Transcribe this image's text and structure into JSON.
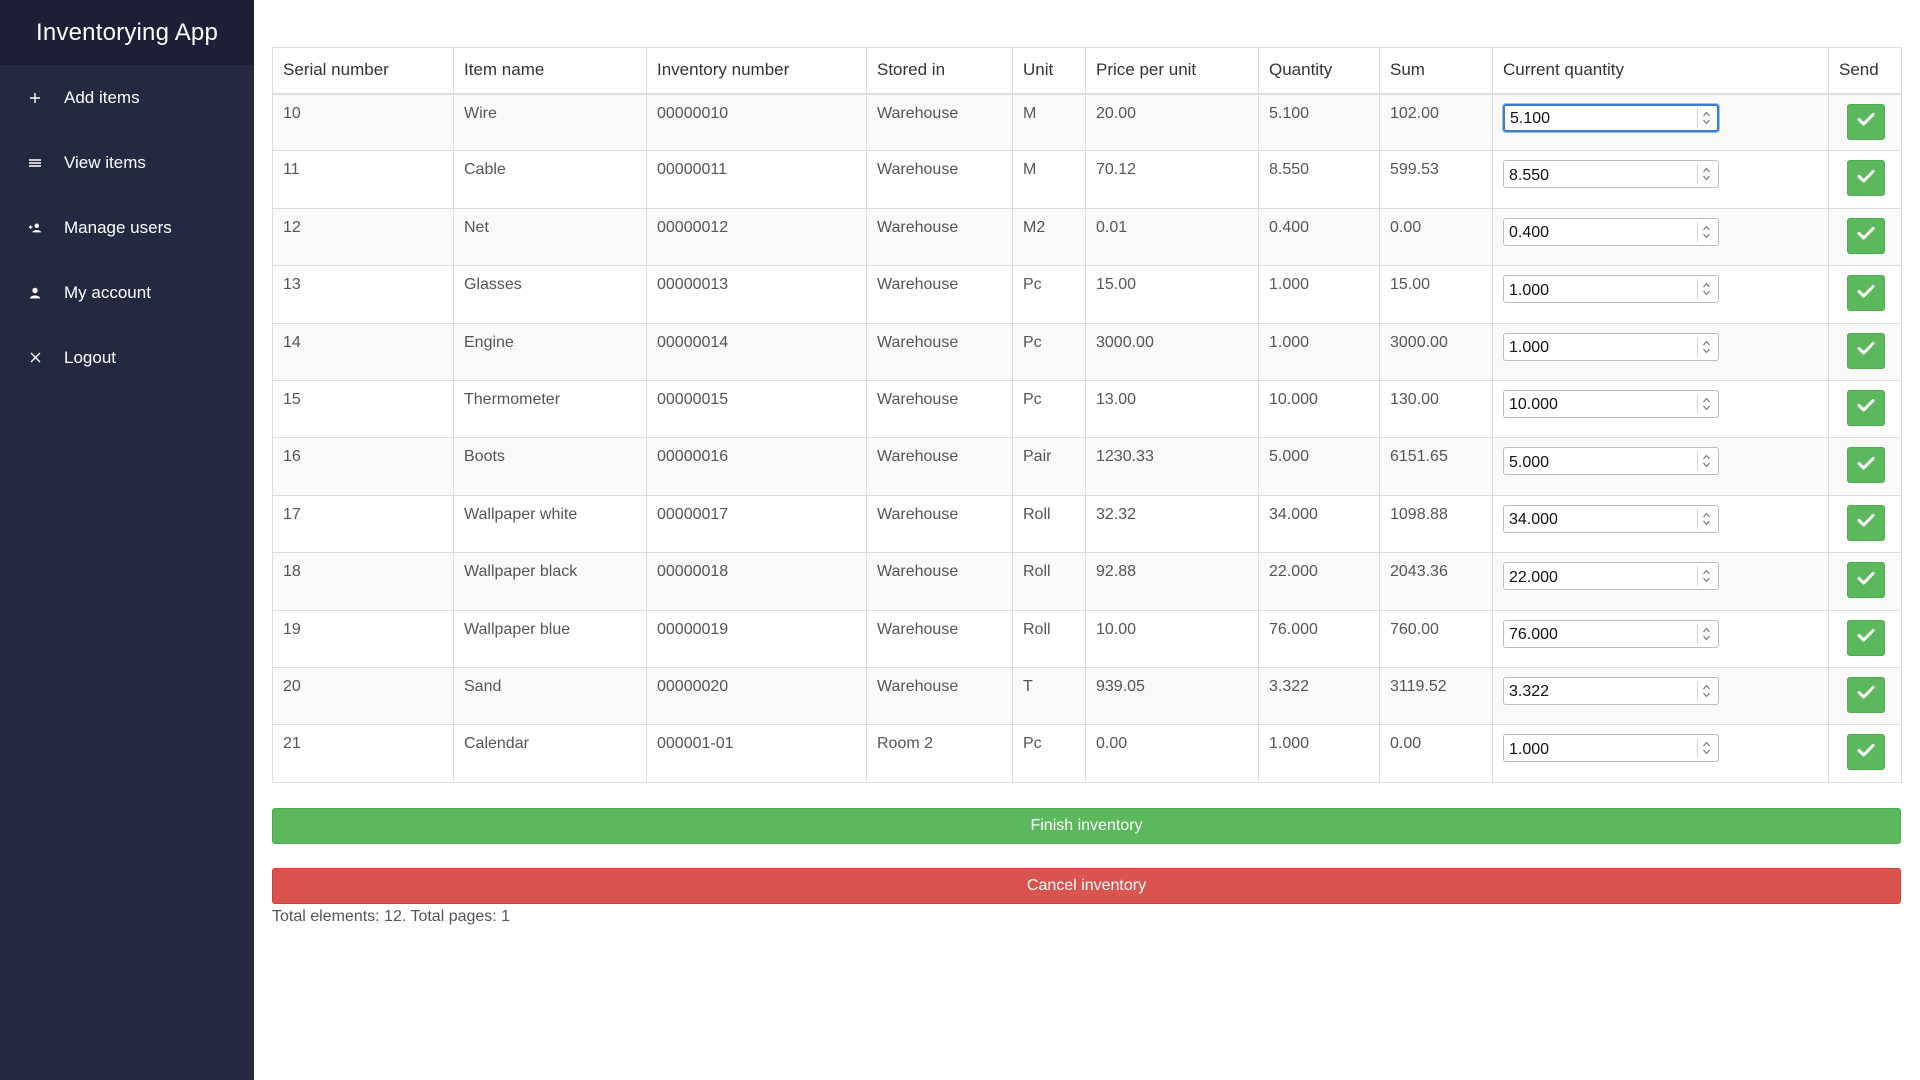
{
  "app": {
    "title": "Inventorying App"
  },
  "sidebar": {
    "items": [
      {
        "label": "Add items",
        "icon": "plus-icon"
      },
      {
        "label": "View items",
        "icon": "list-icon"
      },
      {
        "label": "Manage users",
        "icon": "users-icon"
      },
      {
        "label": "My account",
        "icon": "user-icon"
      },
      {
        "label": "Logout",
        "icon": "close-icon"
      }
    ]
  },
  "table": {
    "headers": [
      "Serial number",
      "Item name",
      "Inventory number",
      "Stored in",
      "Unit",
      "Price per unit",
      "Quantity",
      "Sum",
      "Current quantity",
      "Send"
    ],
    "rows": [
      {
        "serial": "10",
        "name": "Wire",
        "inventory": "00000010",
        "stored": "Warehouse",
        "unit": "M",
        "price": "20.00",
        "quantity": "5.100",
        "sum": "102.00",
        "current": "5.100"
      },
      {
        "serial": "11",
        "name": "Cable",
        "inventory": "00000011",
        "stored": "Warehouse",
        "unit": "M",
        "price": "70.12",
        "quantity": "8.550",
        "sum": "599.53",
        "current": "8.550"
      },
      {
        "serial": "12",
        "name": "Net",
        "inventory": "00000012",
        "stored": "Warehouse",
        "unit": "M2",
        "price": "0.01",
        "quantity": "0.400",
        "sum": "0.00",
        "current": "0.400"
      },
      {
        "serial": "13",
        "name": "Glasses",
        "inventory": "00000013",
        "stored": "Warehouse",
        "unit": "Pc",
        "price": "15.00",
        "quantity": "1.000",
        "sum": "15.00",
        "current": "1.000"
      },
      {
        "serial": "14",
        "name": "Engine",
        "inventory": "00000014",
        "stored": "Warehouse",
        "unit": "Pc",
        "price": "3000.00",
        "quantity": "1.000",
        "sum": "3000.00",
        "current": "1.000"
      },
      {
        "serial": "15",
        "name": "Thermometer",
        "inventory": "00000015",
        "stored": "Warehouse",
        "unit": "Pc",
        "price": "13.00",
        "quantity": "10.000",
        "sum": "130.00",
        "current": "10.000"
      },
      {
        "serial": "16",
        "name": "Boots",
        "inventory": "00000016",
        "stored": "Warehouse",
        "unit": "Pair",
        "price": "1230.33",
        "quantity": "5.000",
        "sum": "6151.65",
        "current": "5.000"
      },
      {
        "serial": "17",
        "name": "Wallpaper white",
        "inventory": "00000017",
        "stored": "Warehouse",
        "unit": "Roll",
        "price": "32.32",
        "quantity": "34.000",
        "sum": "1098.88",
        "current": "34.000"
      },
      {
        "serial": "18",
        "name": "Wallpaper black",
        "inventory": "00000018",
        "stored": "Warehouse",
        "unit": "Roll",
        "price": "92.88",
        "quantity": "22.000",
        "sum": "2043.36",
        "current": "22.000"
      },
      {
        "serial": "19",
        "name": "Wallpaper blue",
        "inventory": "00000019",
        "stored": "Warehouse",
        "unit": "Roll",
        "price": "10.00",
        "quantity": "76.000",
        "sum": "760.00",
        "current": "76.000"
      },
      {
        "serial": "20",
        "name": "Sand",
        "inventory": "00000020",
        "stored": "Warehouse",
        "unit": "T",
        "price": "939.05",
        "quantity": "3.322",
        "sum": "3119.52",
        "current": "3.322"
      },
      {
        "serial": "21",
        "name": "Calendar",
        "inventory": "000001-01",
        "stored": "Room 2",
        "unit": "Pc",
        "price": "0.00",
        "quantity": "1.000",
        "sum": "0.00",
        "current": "1.000"
      }
    ]
  },
  "actions": {
    "finish_label": "Finish inventory",
    "cancel_label": "Cancel inventory"
  },
  "footer": {
    "totals": "Total elements: 12. Total pages: 1"
  },
  "colors": {
    "sidebar": "#222a42",
    "brand": "#1a2035",
    "success": "#5cb85c",
    "danger": "#d9534f",
    "focus": "#3d7bd1"
  }
}
